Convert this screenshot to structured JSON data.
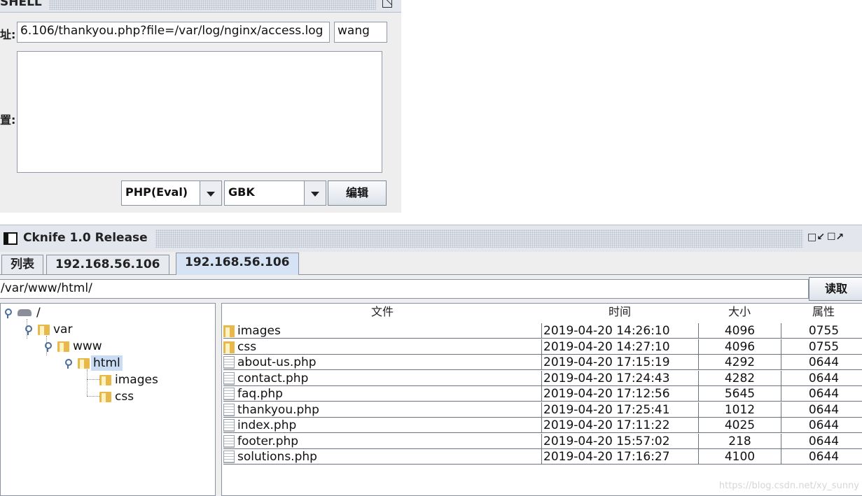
{
  "dialog": {
    "title": "SHELL",
    "url_label": "址:",
    "url_value": "6.106/thankyou.php?file=/var/log/nginx/access.log",
    "password_value": "wang",
    "config_label": "置:",
    "config_value": "",
    "type_select": "PHP(Eval)",
    "encoding_select": "GBK",
    "edit_button": "编辑"
  },
  "window": {
    "title": "Cknife 1.0 Release",
    "tabs": [
      "列表",
      "192.168.56.106",
      "192.168.56.106"
    ],
    "path_value": "/var/www/html/",
    "read_button": "读取",
    "watermark": "https://blog.csdn.net/xy_sunny"
  },
  "tree": {
    "root": "/",
    "nodes": [
      "var",
      "www",
      "html",
      "images",
      "css"
    ]
  },
  "table": {
    "headers": [
      "文件",
      "时间",
      "大小",
      "属性"
    ],
    "rows": [
      {
        "type": "folder",
        "name": "images",
        "time": "2019-04-20 14:26:10",
        "size": "4096",
        "attr": "0755"
      },
      {
        "type": "folder",
        "name": "css",
        "time": "2019-04-20 14:27:10",
        "size": "4096",
        "attr": "0755"
      },
      {
        "type": "file",
        "name": "about-us.php",
        "time": "2019-04-20 17:15:19",
        "size": "4292",
        "attr": "0644"
      },
      {
        "type": "file",
        "name": "contact.php",
        "time": "2019-04-20 17:24:43",
        "size": "4282",
        "attr": "0644"
      },
      {
        "type": "file",
        "name": "faq.php",
        "time": "2019-04-20 17:12:56",
        "size": "5645",
        "attr": "0644"
      },
      {
        "type": "file",
        "name": "thankyou.php",
        "time": "2019-04-20 17:25:41",
        "size": "1012",
        "attr": "0644"
      },
      {
        "type": "file",
        "name": "index.php",
        "time": "2019-04-20 17:11:22",
        "size": "4025",
        "attr": "0644"
      },
      {
        "type": "file",
        "name": "footer.php",
        "time": "2019-04-20 15:57:02",
        "size": "218",
        "attr": "0644"
      },
      {
        "type": "file",
        "name": "solutions.php",
        "time": "2019-04-20 17:16:27",
        "size": "4100",
        "attr": "0644"
      }
    ]
  }
}
